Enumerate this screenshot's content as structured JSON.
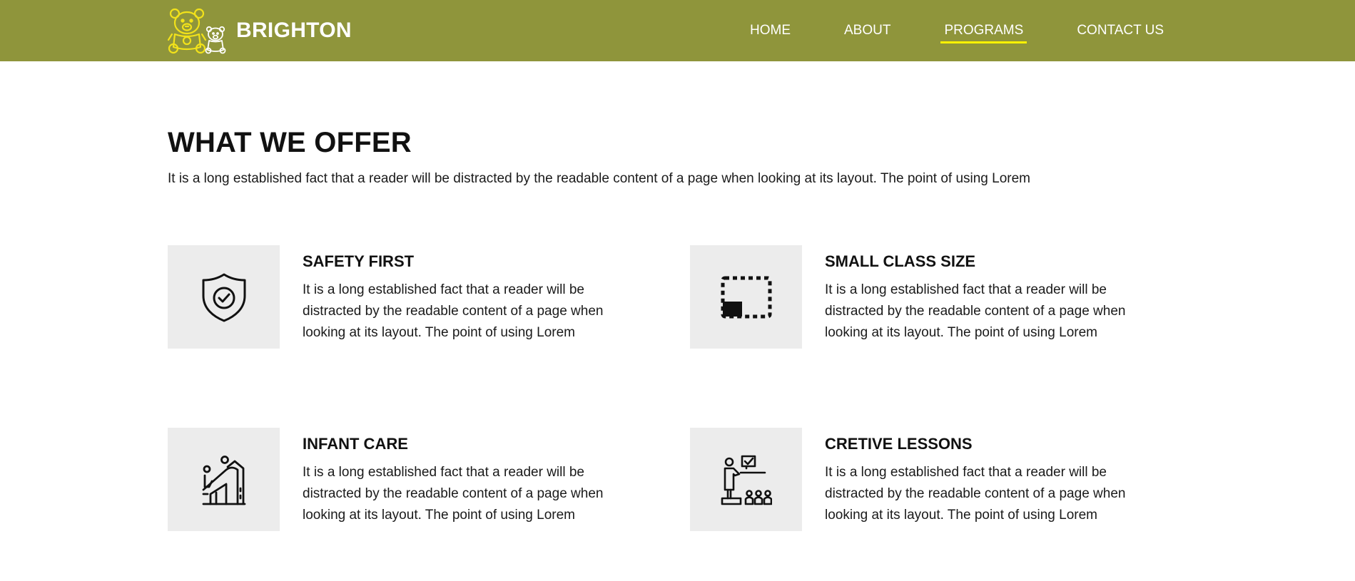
{
  "brand": {
    "name": "BRIGHTON",
    "logo_icon": "teddy-bear-icon"
  },
  "nav": {
    "items": [
      {
        "label": "HOME"
      },
      {
        "label": "ABOUT"
      },
      {
        "label": "PROGRAMS",
        "active": true
      },
      {
        "label": "CONTACT US"
      }
    ]
  },
  "colors": {
    "header_bg": "#8f953b",
    "active_underline": "#fff200",
    "logo": "#f2e21a",
    "icon_box_bg": "#ececec"
  },
  "offer": {
    "title": "WHAT WE OFFER",
    "intro": "It is a long established fact that a reader will be distracted by the readable content of a page when looking at its layout. The point of using Lorem",
    "cards": [
      {
        "icon": "shield-check-icon",
        "title": "SAFETY FIRST",
        "text": "It is a long established fact that a reader will be distracted by the readable content of a page when looking at its layout. The point of using Lorem"
      },
      {
        "icon": "dashed-frame-icon",
        "title": "SMALL CLASS SIZE",
        "text": "It is a long established fact that a reader will be distracted by the readable content of a page when looking at its layout. The point of using Lorem"
      },
      {
        "icon": "playground-slide-icon",
        "title": "INFANT CARE",
        "text": "It is a long established fact that a reader will be distracted by the readable content of a page when looking at its layout. The point of using Lorem"
      },
      {
        "icon": "teacher-classroom-icon",
        "title": "CRETIVE LESSONS",
        "text": "It is a long established fact that a reader will be distracted by the readable content of a page when looking at its layout. The point of using Lorem"
      }
    ]
  }
}
